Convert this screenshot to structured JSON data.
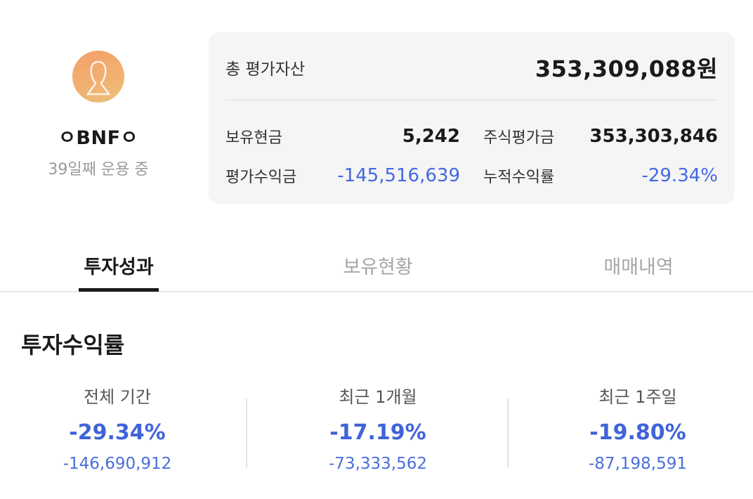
{
  "profile": {
    "avatar_icon": "person-silhouette-icon",
    "nickname": "ㅇBNFㅇ",
    "days_running": "39일째 운용 중"
  },
  "summary": {
    "total_label": "총 평가자산",
    "total_value": "353,309,088원",
    "cash_label": "보유현금",
    "cash_value": "5,242",
    "stock_label": "주식평가금",
    "stock_value": "353,303,846",
    "pnl_label": "평가수익금",
    "pnl_value": "-145,516,639",
    "cum_label": "누적수익률",
    "cum_value": "-29.34%"
  },
  "tabs": [
    {
      "label": "투자성과",
      "active": true
    },
    {
      "label": "보유현황",
      "active": false
    },
    {
      "label": "매매내역",
      "active": false
    }
  ],
  "section": {
    "title": "투자수익률"
  },
  "returns": [
    {
      "period": "전체 기간",
      "percent": "-29.34%",
      "amount": "-146,690,912"
    },
    {
      "period": "최근 1개월",
      "percent": "-17.19%",
      "amount": "-73,333,562"
    },
    {
      "period": "최근 1주일",
      "percent": "-19.80%",
      "amount": "-87,198,591"
    }
  ],
  "colors": {
    "negative": "#3f63d8",
    "card_bg": "#f5f5f5",
    "avatar_start": "#f3a06a",
    "avatar_end": "#e9c27a"
  }
}
